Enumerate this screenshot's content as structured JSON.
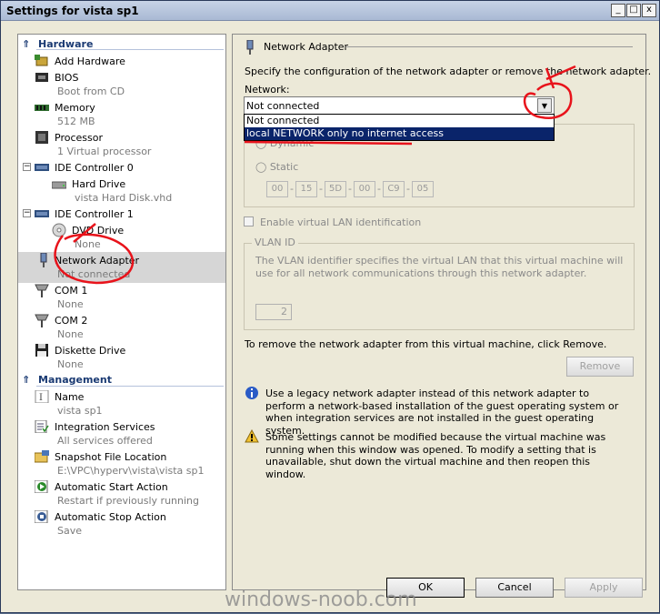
{
  "window": {
    "title": "Settings for vista sp1",
    "min": "_",
    "max": "□",
    "close": "x"
  },
  "sidebar": {
    "hardware_header": "Hardware",
    "management_header": "Management",
    "items": [
      {
        "name": "Add Hardware",
        "sub": ""
      },
      {
        "name": "BIOS",
        "sub": "Boot from CD"
      },
      {
        "name": "Memory",
        "sub": "512 MB"
      },
      {
        "name": "Processor",
        "sub": "1 Virtual processor"
      },
      {
        "name": "IDE Controller 0",
        "sub": ""
      },
      {
        "name": "Hard Drive",
        "sub": "vista Hard Disk.vhd"
      },
      {
        "name": "IDE Controller 1",
        "sub": ""
      },
      {
        "name": "DVD Drive",
        "sub": "None"
      },
      {
        "name": "Network Adapter",
        "sub": "Not connected"
      },
      {
        "name": "COM 1",
        "sub": "None"
      },
      {
        "name": "COM 2",
        "sub": "None"
      },
      {
        "name": "Diskette Drive",
        "sub": "None"
      }
    ],
    "mgmt_items": [
      {
        "name": "Name",
        "sub": "vista sp1"
      },
      {
        "name": "Integration Services",
        "sub": "All services offered"
      },
      {
        "name": "Snapshot File Location",
        "sub": "E:\\VPC\\hyperv\\vista\\vista sp1"
      },
      {
        "name": "Automatic Start Action",
        "sub": "Restart if previously running"
      },
      {
        "name": "Automatic Stop Action",
        "sub": "Save"
      }
    ]
  },
  "panel": {
    "title": "Network Adapter",
    "description": "Specify the configuration of the network adapter or remove the network adapter.",
    "network_label": "Network:",
    "network_value": "Not connected",
    "dropdown_options": [
      "Not connected",
      "local NETWORK only no internet access"
    ],
    "dropdown_selected_index": 1,
    "mac_dynamic": "Dynamic",
    "mac_static": "Static",
    "mac_octets": [
      "00",
      "15",
      "5D",
      "00",
      "C9",
      "05"
    ],
    "vlan_checkbox": "Enable virtual LAN identification",
    "vlan_group": "VLAN ID",
    "vlan_desc": "The VLAN identifier specifies the virtual LAN that this virtual machine will use for all network communications through this network adapter.",
    "vlan_value": "2",
    "remove_text": "To remove the network adapter from this virtual machine, click Remove.",
    "remove_button": "Remove",
    "info_text": "Use a legacy network adapter instead of this network adapter to perform a network-based installation of the guest operating system or when integration services are not installed in the guest operating system.",
    "warning_text": "Some settings cannot be modified because the virtual machine was running when this window was opened. To modify a setting that is unavailable, shut down the virtual machine and then reopen this window."
  },
  "footer": {
    "ok": "OK",
    "cancel": "Cancel",
    "apply": "Apply"
  },
  "watermark": "windows-noob.com",
  "colors": {
    "accent": "#1a3a73",
    "selection": "#0a246a",
    "annotation": "#e8131b"
  }
}
